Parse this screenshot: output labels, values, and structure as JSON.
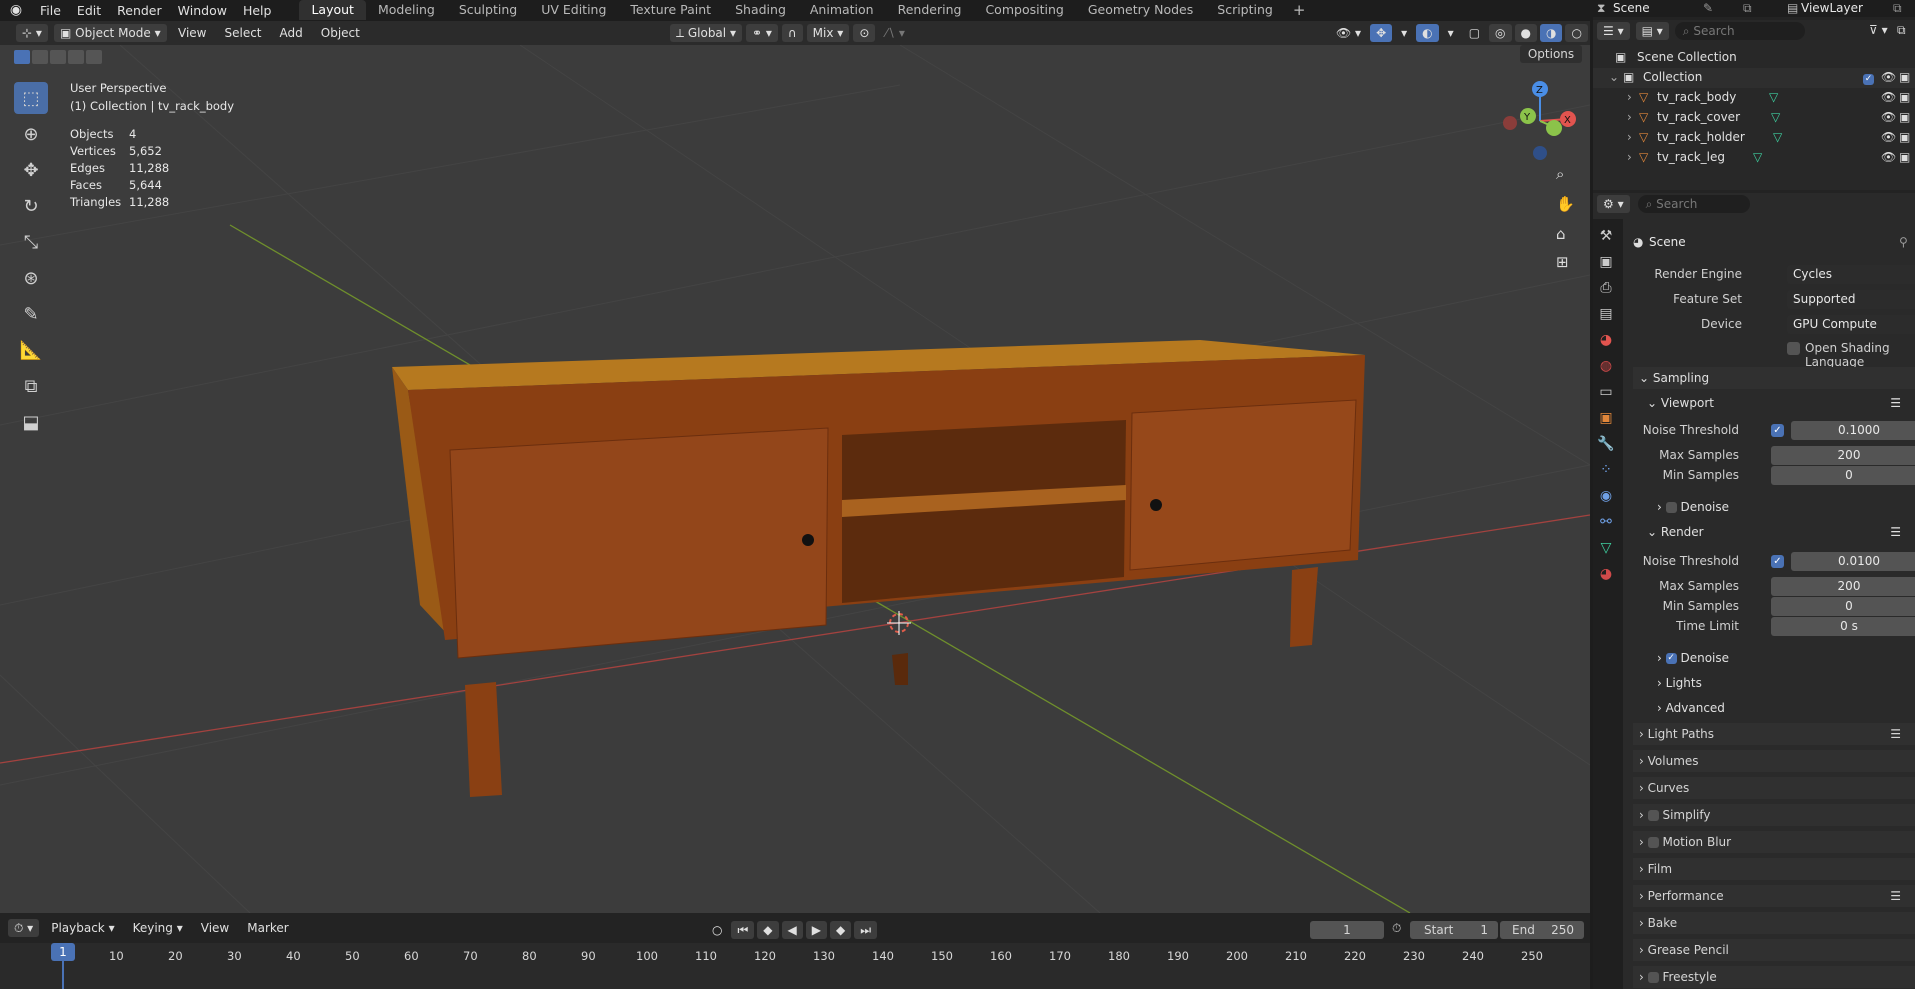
{
  "menu": {
    "items": [
      "File",
      "Edit",
      "Render",
      "Window",
      "Help"
    ]
  },
  "workspaces": [
    "Layout",
    "Modeling",
    "Sculpting",
    "UV Editing",
    "Texture Paint",
    "Shading",
    "Animation",
    "Rendering",
    "Compositing",
    "Geometry Nodes",
    "Scripting"
  ],
  "scene": {
    "name": "Scene",
    "view_layer": "ViewLayer"
  },
  "vp_header": {
    "mode": "Object Mode",
    "menus": [
      "View",
      "Select",
      "Add",
      "Object"
    ],
    "orientation": "Global",
    "snap": "Mix",
    "options": "Options"
  },
  "overlay": {
    "perspective": "User Perspective",
    "collection_line": "(1) Collection | tv_rack_body"
  },
  "stats": [
    {
      "label": "Objects",
      "value": "4"
    },
    {
      "label": "Vertices",
      "value": "5,652"
    },
    {
      "label": "Edges",
      "value": "11,288"
    },
    {
      "label": "Faces",
      "value": "5,644"
    },
    {
      "label": "Triangles",
      "value": "11,288"
    }
  ],
  "gizmo": {
    "x": "X",
    "y": "Y",
    "z": "Z"
  },
  "outliner": {
    "search_placeholder": "Search",
    "scene_collection": "Scene Collection",
    "collection": "Collection",
    "objects": [
      "tv_rack_body",
      "tv_rack_cover",
      "tv_rack_holder",
      "tv_rack_leg"
    ]
  },
  "properties": {
    "search_placeholder": "Search",
    "context": "Scene",
    "render_engine_label": "Render Engine",
    "render_engine": "Cycles",
    "feature_set_label": "Feature Set",
    "feature_set": "Supported",
    "device_label": "Device",
    "device": "GPU Compute",
    "osl_label": "Open Shading Language",
    "sampling": "Sampling",
    "viewport": "Viewport",
    "noise_threshold_label": "Noise Threshold",
    "viewport_noise_threshold": "0.1000",
    "max_samples_label": "Max Samples",
    "viewport_max_samples": "200",
    "min_samples_label": "Min Samples",
    "viewport_min_samples": "0",
    "denoise_label": "Denoise",
    "render": "Render",
    "render_noise_threshold": "0.0100",
    "render_max_samples": "200",
    "render_min_samples": "0",
    "time_limit_label": "Time Limit",
    "render_time_limit": "0 s",
    "lights": "Lights",
    "advanced": "Advanced",
    "panels": [
      "Light Paths",
      "Volumes",
      "Curves",
      "Simplify",
      "Motion Blur",
      "Film",
      "Performance",
      "Bake",
      "Grease Pencil",
      "Freestyle"
    ]
  },
  "timeline": {
    "menus": [
      "Playback",
      "Keying",
      "View",
      "Marker"
    ],
    "current_frame": "1",
    "start_label": "Start",
    "start": "1",
    "end_label": "End",
    "end": "250",
    "ticks": [
      "1",
      "10",
      "20",
      "30",
      "40",
      "50",
      "60",
      "70",
      "80",
      "90",
      "100",
      "110",
      "120",
      "130",
      "140",
      "150",
      "160",
      "170",
      "180",
      "190",
      "200",
      "210",
      "220",
      "230",
      "240",
      "250"
    ]
  },
  "colors": {
    "accent": "#4a72b5",
    "x_axis": "#e2544f",
    "y_axis": "#8bc34a",
    "z_axis": "#4a8ee6",
    "wood": "#8a3f12"
  }
}
